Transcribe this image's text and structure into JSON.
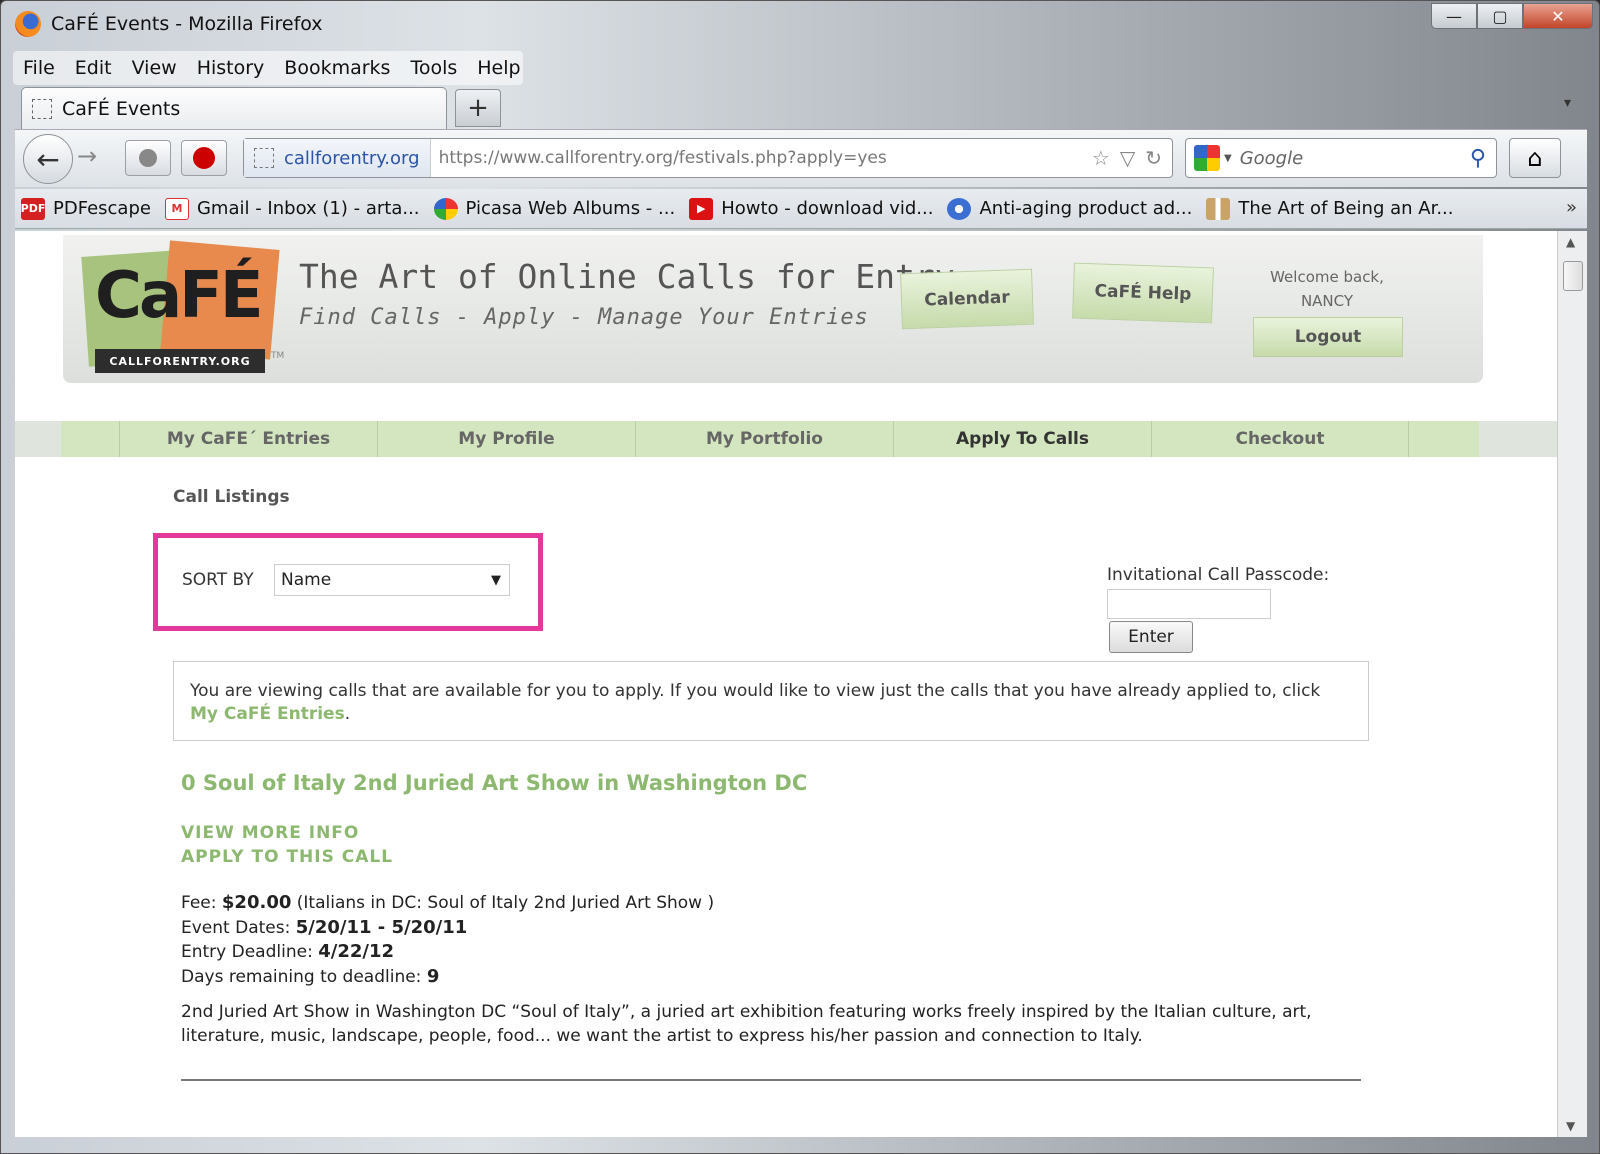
{
  "window": {
    "title": "CaFÉ Events - Mozilla Firefox",
    "controls": {
      "minimize": "—",
      "maximize": "▢",
      "close": "✕"
    }
  },
  "menu": [
    "File",
    "Edit",
    "View",
    "History",
    "Bookmarks",
    "Tools",
    "Help"
  ],
  "tab": {
    "label": "CaFÉ Events",
    "new_tab": "+",
    "overflow": "▾"
  },
  "navbar": {
    "back": "←",
    "forward": "→",
    "identity": "callforentry.org",
    "url": "https://www.callforentry.org/festivals.php?apply=yes",
    "star": "☆",
    "dropdown": "▽",
    "reload": "↻",
    "search_placeholder": "Google",
    "search_icon": "⚲",
    "home": "⌂"
  },
  "bookmarks": [
    {
      "label": "PDFescape",
      "icon": "pdf-icon",
      "icon_text": "PDF",
      "color": "#d42020"
    },
    {
      "label": "Gmail - Inbox (1) - arta...",
      "icon": "gmail-icon",
      "icon_text": "M",
      "color": "#d33"
    },
    {
      "label": "Picasa Web Albums - ...",
      "icon": "picasa-icon",
      "icon_text": "",
      "color": "#3a8"
    },
    {
      "label": "Howto - download vid...",
      "icon": "youtube-icon",
      "icon_text": "▶",
      "color": "#d11"
    },
    {
      "label": "Anti-aging product ad...",
      "icon": "globe-icon",
      "icon_text": "",
      "color": "#3b6fd1"
    },
    {
      "label": "The Art of Being an Ar...",
      "icon": "book-icon",
      "icon_text": "",
      "color": "#c9a36a"
    }
  ],
  "bookmarks_more": "»",
  "site": {
    "logo_text": "CaFÉ",
    "logo_sub": "CALLFORENTRY.ORG",
    "logo_tm": "TM",
    "tagline_main": "The Art of Online Calls for Entry",
    "tagline_sub": "Find Calls - Apply - Manage Your Entries",
    "calendar": "Calendar",
    "help": "CaFÉ Help",
    "welcome": "Welcome back,",
    "user": "NANCY",
    "logout": "Logout"
  },
  "nav_tabs": [
    "My CaFE´ Entries",
    "My Profile",
    "My Portfolio",
    "Apply To Calls",
    "Checkout"
  ],
  "active_nav": "Apply To Calls",
  "main": {
    "section_title": "Call Listings",
    "sort_label": "SORT BY",
    "sort_value": "Name",
    "passcode_label": "Invitational Call Passcode:",
    "enter_button": "Enter",
    "info_text": "You are viewing calls that are available for you to apply. If you would like to view just the calls that you have already applied to, click ",
    "info_link": "My CaFÉ Entries",
    "info_end": ".",
    "call": {
      "title": "0 Soul of Italy 2nd Juried Art Show in Washington DC",
      "view_more": "VIEW MORE INFO",
      "apply": "APPLY TO THIS CALL",
      "fee_label": "Fee: ",
      "fee": "$20.00",
      "fee_note": " (Italians in DC: Soul of Italy 2nd Juried Art Show )",
      "event_dates_label": "Event Dates: ",
      "event_dates": "5/20/11 - 5/20/11",
      "deadline_label": "Entry Deadline: ",
      "deadline": "4/22/12",
      "days_label": "Days remaining to deadline: ",
      "days": "9",
      "description": "2nd Juried Art Show in Washington DC “Soul of Italy”, a juried art exhibition featuring works freely inspired by the Italian culture, art, literature, music, landscape, people, food... we want the artist to express his/her passion and connection to Italy."
    }
  },
  "colors": {
    "accent_green": "#8cb870",
    "highlight_pink": "#e4399b",
    "nav_green": "#d3e6bf"
  }
}
